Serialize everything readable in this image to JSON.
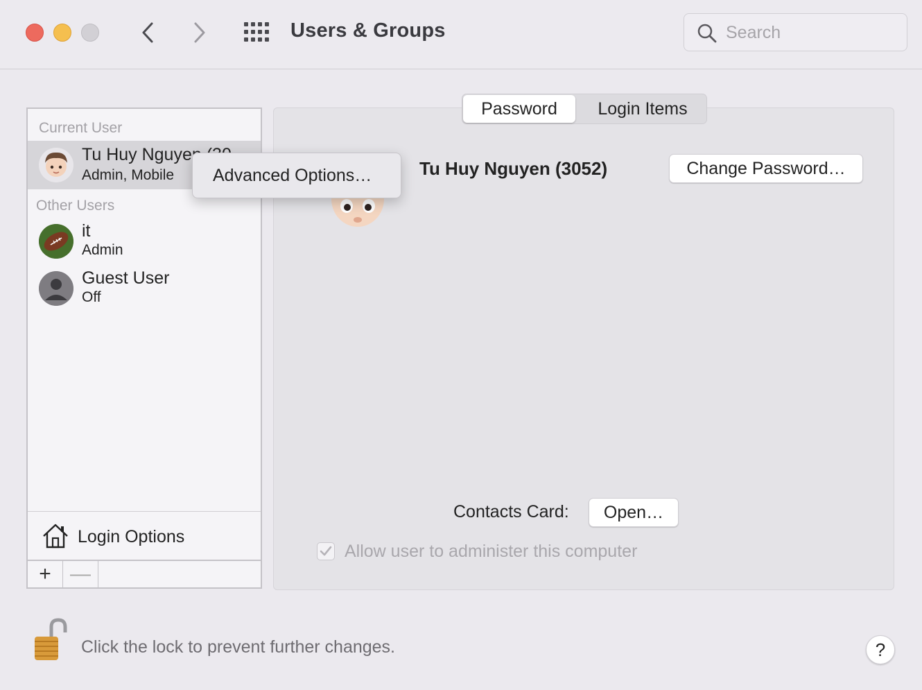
{
  "window": {
    "title": "Users & Groups"
  },
  "search": {
    "placeholder": "Search"
  },
  "sidebar": {
    "current_user_label": "Current User",
    "other_users_label": "Other Users",
    "users": [
      {
        "name": "Tu Huy Nguyen (30",
        "role": "Admin, Mobile",
        "avatar": "memoji-avatar"
      },
      {
        "name": "it",
        "role": "Admin",
        "avatar": "football-avatar"
      },
      {
        "name": "Guest User",
        "role": "Off",
        "avatar": "generic-person-avatar"
      }
    ],
    "login_options_label": "Login Options",
    "add_label": "+",
    "remove_label": "—"
  },
  "tabs": [
    {
      "label": "Password",
      "active": true
    },
    {
      "label": "Login Items",
      "active": false
    }
  ],
  "details": {
    "full_name": "Tu Huy Nguyen (3052)",
    "change_password_label": "Change Password…",
    "contacts_card_label": "Contacts Card:",
    "open_label": "Open…",
    "allow_admin_label": "Allow user to administer this computer",
    "allow_admin_checked": true
  },
  "context_menu": {
    "item": "Advanced Options…"
  },
  "footer": {
    "lock_text": "Click the lock to prevent further changes.",
    "help_label": "?"
  }
}
